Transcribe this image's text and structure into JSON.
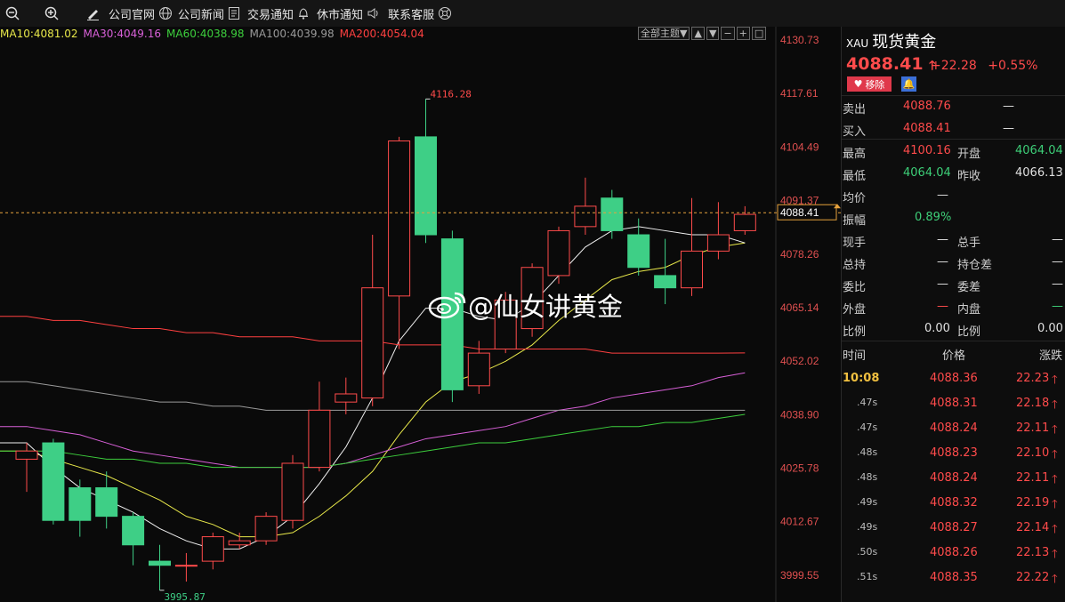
{
  "toolbar": {
    "items": [
      "公司官网",
      "公司新闻",
      "交易通知",
      "休市通知",
      "联系客服"
    ]
  },
  "ma_legend": [
    {
      "text": "MA10:4081.02",
      "color": "#e8e84a"
    },
    {
      "text": "MA30:4049.16",
      "color": "#d860d8"
    },
    {
      "text": "MA60:4038.98",
      "color": "#3dcf3d"
    },
    {
      "text": "MA100:4039.98",
      "color": "#9a9a9a"
    },
    {
      "text": "MA200:4054.04",
      "color": "#ff4040"
    }
  ],
  "chart_controls": {
    "theme": "全部主题▼"
  },
  "watermark": "@仙女讲黄金",
  "chart_data": {
    "type": "candlestick",
    "symbol": "XAU",
    "ylim": [
      3993,
      4134
    ],
    "y_ticks": [
      "4130.73",
      "4117.61",
      "4104.49",
      "4091.37",
      "4078.26",
      "4065.14",
      "4052.02",
      "4038.90",
      "4025.78",
      "4012.67",
      "3999.55"
    ],
    "current_price": "4088.41",
    "high_marker": "4116.28",
    "low_marker": "3995.87",
    "candles": [
      {
        "o": 4028,
        "h": 4032,
        "l": 4020,
        "c": 4030
      },
      {
        "o": 4032,
        "h": 4033,
        "l": 4012,
        "c": 4013
      },
      {
        "o": 4021,
        "h": 4023,
        "l": 4009,
        "c": 4013
      },
      {
        "o": 4021,
        "h": 4025,
        "l": 4011,
        "c": 4014
      },
      {
        "o": 4014,
        "h": 4015,
        "l": 4002,
        "c": 4007
      },
      {
        "o": 4003,
        "h": 4007,
        "l": 3995.87,
        "c": 4002
      },
      {
        "o": 4002,
        "h": 4005,
        "l": 3998,
        "c": 4002
      },
      {
        "o": 4003,
        "h": 4010,
        "l": 4001,
        "c": 4009
      },
      {
        "o": 4007,
        "h": 4010,
        "l": 4006,
        "c": 4008
      },
      {
        "o": 4008,
        "h": 4015,
        "l": 4007,
        "c": 4014
      },
      {
        "o": 4013,
        "h": 4029,
        "l": 4011,
        "c": 4027
      },
      {
        "o": 4026,
        "h": 4047,
        "l": 4025,
        "c": 4040
      },
      {
        "o": 4042,
        "h": 4048,
        "l": 4039,
        "c": 4044
      },
      {
        "o": 4043,
        "h": 4083,
        "l": 4041,
        "c": 4070
      },
      {
        "o": 4068,
        "h": 4107,
        "l": 4055,
        "c": 4106
      },
      {
        "o": 4107,
        "h": 4116.28,
        "l": 4081,
        "c": 4083
      },
      {
        "o": 4082,
        "h": 4084,
        "l": 4042,
        "c": 4045
      },
      {
        "o": 4046,
        "h": 4057,
        "l": 4044,
        "c": 4054
      },
      {
        "o": 4055,
        "h": 4069,
        "l": 4054,
        "c": 4067
      },
      {
        "o": 4060,
        "h": 4076,
        "l": 4058,
        "c": 4075
      },
      {
        "o": 4073,
        "h": 4085,
        "l": 4071,
        "c": 4084
      },
      {
        "o": 4085,
        "h": 4097,
        "l": 4083,
        "c": 4090
      },
      {
        "o": 4092,
        "h": 4094,
        "l": 4082,
        "c": 4084
      },
      {
        "o": 4083,
        "h": 4087,
        "l": 4073,
        "c": 4075
      },
      {
        "o": 4073,
        "h": 4082,
        "l": 4066,
        "c": 4070
      },
      {
        "o": 4070,
        "h": 4092,
        "l": 4068,
        "c": 4079
      },
      {
        "o": 4079,
        "h": 4091,
        "l": 4077,
        "c": 4083
      },
      {
        "o": 4084,
        "h": 4090,
        "l": 4083,
        "c": 4088
      }
    ],
    "series": [
      {
        "name": "MA10",
        "color": "#e8e84a",
        "values": [
          4030,
          4028,
          4026,
          4024,
          4021,
          4018,
          4014,
          4012,
          4009,
          4009,
          4010,
          4014,
          4019,
          4025,
          4034,
          4042,
          4047,
          4049,
          4052,
          4056,
          4062,
          4067,
          4072,
          4074,
          4075,
          4078,
          4080,
          4081
        ]
      },
      {
        "name": "MA",
        "color": "#f0f0f0",
        "values": [
          4032,
          4026,
          4021,
          4018,
          4015,
          4011,
          4008,
          4006,
          4006,
          4009,
          4014,
          4022,
          4031,
          4043,
          4057,
          4065,
          4065,
          4063,
          4062,
          4066,
          4073,
          4080,
          4084,
          4085,
          4084,
          4083,
          4083,
          4081
        ]
      },
      {
        "name": "MA30",
        "color": "#d860d8",
        "values": [
          4036,
          4035,
          4034,
          4032,
          4030,
          4029,
          4028,
          4027,
          4026,
          4026,
          4026,
          4026,
          4027,
          4029,
          4031,
          4033,
          4034,
          4035,
          4036,
          4038,
          4040,
          4041,
          4043,
          4044,
          4045,
          4046,
          4048,
          4049.16
        ]
      },
      {
        "name": "MA60",
        "color": "#3dcf3d",
        "values": [
          4030,
          4030,
          4029,
          4028,
          4028,
          4027,
          4027,
          4026,
          4026,
          4026,
          4026,
          4026,
          4027,
          4028,
          4029,
          4030,
          4031,
          4032,
          4032,
          4033,
          4034,
          4035,
          4036,
          4036,
          4037,
          4037,
          4038,
          4038.98
        ]
      },
      {
        "name": "MA100",
        "color": "#9a9a9a",
        "values": [
          4047,
          4046,
          4045,
          4044,
          4043,
          4042,
          4042,
          4041,
          4041,
          4040,
          4040,
          4040,
          4040,
          4040,
          4040,
          4040,
          4040,
          4040,
          4040,
          4040,
          4040,
          4040,
          4040,
          4040,
          4040,
          4040,
          4040,
          4039.98
        ]
      },
      {
        "name": "MA200",
        "color": "#ff4040",
        "values": [
          4063,
          4062,
          4062,
          4061,
          4060,
          4060,
          4059,
          4059,
          4058,
          4058,
          4058,
          4057,
          4057,
          4057,
          4056,
          4056,
          4056,
          4055,
          4055,
          4055,
          4055,
          4055,
          4054,
          4054,
          4054,
          4054,
          4054,
          4054.04
        ]
      }
    ]
  },
  "quote": {
    "symbol": "XAU",
    "name": "现货黄金",
    "price": "4088.41",
    "change": "+22.28",
    "change_pct": "+0.55%",
    "remove_label": "移除",
    "sell_label": "卖出",
    "sell_price": "4088.76",
    "sell_vol": "—",
    "buy_label": "买入",
    "buy_price": "4088.41",
    "buy_vol": "—",
    "high_label": "最高",
    "high": "4100.16",
    "open_label": "开盘",
    "open": "4064.04",
    "low_label": "最低",
    "low": "4064.04",
    "prev_label": "昨收",
    "prev": "4066.13",
    "avg_label": "均价",
    "avg": "—",
    "amp_label": "振幅",
    "amp": "0.89%",
    "now_hand_label": "现手",
    "now_hand": "—",
    "total_hand_label": "总手",
    "total_hand": "—",
    "total_hold_label": "总持",
    "total_hold": "—",
    "hold_diff_label": "持仓差",
    "hold_diff": "—",
    "ratio_label": "委比",
    "ratio": "—",
    "diff_label": "委差",
    "diff": "—",
    "outer_label": "外盘",
    "outer": "—",
    "inner_label": "内盘",
    "inner": "—",
    "bili1_label": "比例",
    "bili1": "0.00",
    "bili2_label": "比例",
    "bili2": "0.00"
  },
  "ticks": {
    "headers": [
      "时间",
      "价格",
      "涨跌"
    ],
    "rows": [
      {
        "time": "10:08",
        "price": "4088.36",
        "chg": "22.23"
      },
      {
        "time": ".47s",
        "price": "4088.31",
        "chg": "22.18"
      },
      {
        "time": ".47s",
        "price": "4088.24",
        "chg": "22.11"
      },
      {
        "time": ".48s",
        "price": "4088.23",
        "chg": "22.10"
      },
      {
        "time": ".48s",
        "price": "4088.24",
        "chg": "22.11"
      },
      {
        "time": ".49s",
        "price": "4088.32",
        "chg": "22.19"
      },
      {
        "time": ".49s",
        "price": "4088.27",
        "chg": "22.14"
      },
      {
        "time": ".50s",
        "price": "4088.26",
        "chg": "22.13"
      },
      {
        "time": ".51s",
        "price": "4088.35",
        "chg": "22.22"
      }
    ]
  }
}
